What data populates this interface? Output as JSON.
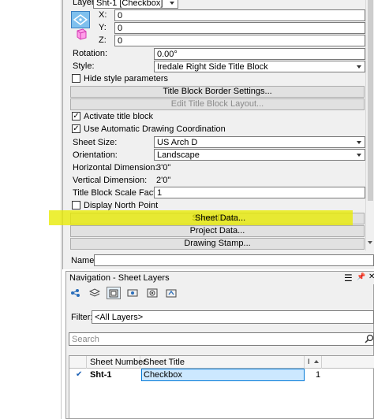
{
  "properties": {
    "layer": {
      "label": "Layer:",
      "value": "Sht-1 [Checkbox]"
    },
    "x": {
      "label": "X:",
      "value": "0"
    },
    "y": {
      "label": "Y:",
      "value": "0"
    },
    "z": {
      "label": "Z:",
      "value": "0"
    },
    "rotation": {
      "label": "Rotation:",
      "value": "0.00°"
    },
    "style": {
      "label": "Style:",
      "value": "Iredale Right Side Title Block"
    },
    "hide_style_params": {
      "label": "Hide style parameters",
      "checked": false
    },
    "title_block_border_btn": "Title Block Border Settings...",
    "edit_title_block_btn": "Edit Title Block Layout...",
    "activate_title_block": {
      "label": "Activate title block",
      "checked": true
    },
    "use_auto_coord": {
      "label": "Use Automatic Drawing Coordination",
      "checked": true
    },
    "sheet_size": {
      "label": "Sheet Size:",
      "value": "US Arch D"
    },
    "orientation": {
      "label": "Orientation:",
      "value": "Landscape"
    },
    "horizontal_dim": {
      "label": "Horizontal Dimension:",
      "value": "3'0\""
    },
    "vertical_dim": {
      "label": "Vertical Dimension:",
      "value": "2'0\""
    },
    "scale_factor": {
      "label": "Title Block Scale Factor:",
      "value": "1"
    },
    "display_north_point": {
      "label": "Display North Point",
      "checked": false
    },
    "sheet_data_btn": "Sheet Data...",
    "project_data_btn": "Project Data...",
    "drawing_stamp_btn": "Drawing Stamp...",
    "name": {
      "label": "Name:",
      "value": ""
    }
  },
  "navigation": {
    "title": "Navigation - Sheet Layers",
    "menu_glyph": "☰",
    "pin_glyph": "📌",
    "close_glyph": "✕",
    "filter": {
      "label": "Filter:",
      "value": "<All Layers>"
    },
    "search": {
      "placeholder": "Search"
    },
    "table": {
      "columns": [
        "Sheet Number",
        "Sheet Title",
        "I"
      ],
      "rows": [
        {
          "check": "✔",
          "number": "Sht-1",
          "title": "Checkbox",
          "value": "1"
        }
      ]
    }
  },
  "colors": {
    "highlight": "#e8ea00",
    "panel_bg": "#f0f0f0",
    "selection": "#cce8ff"
  },
  "icons": [
    "flyover-icon",
    "layers-icon",
    "sheet-icon",
    "saved-views-icon",
    "visibility-icon",
    "design-layers-icon"
  ]
}
